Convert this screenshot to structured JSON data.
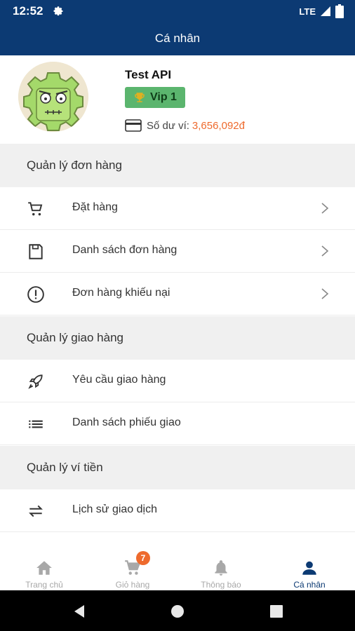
{
  "status_bar": {
    "time": "12:52",
    "network": "LTE"
  },
  "app_bar": {
    "title": "Cá nhân"
  },
  "profile": {
    "name": "Test API",
    "vip_label": "Vip 1",
    "balance_label": "Số dư ví:",
    "balance_value": "3,656,092đ"
  },
  "sections": [
    {
      "title": "Quản lý đơn hàng",
      "items": [
        {
          "label": "Đặt hàng",
          "icon": "cart-icon"
        },
        {
          "label": "Danh sách đơn hàng",
          "icon": "save-icon"
        },
        {
          "label": "Đơn hàng khiếu nại",
          "icon": "alert-circle-icon"
        }
      ]
    },
    {
      "title": "Quản lý giao hàng",
      "items": [
        {
          "label": "Yêu cầu giao hàng",
          "icon": "rocket-icon"
        },
        {
          "label": "Danh sách phiếu giao",
          "icon": "list-icon"
        }
      ]
    },
    {
      "title": "Quản lý ví tiền",
      "items": [
        {
          "label": "Lịch sử giao dịch",
          "icon": "swap-icon"
        }
      ]
    }
  ],
  "bottom_nav": [
    {
      "label": "Trang chủ",
      "icon": "home-icon"
    },
    {
      "label": "Giỏ hàng",
      "icon": "cart-icon",
      "badge": "7"
    },
    {
      "label": "Thông báo",
      "icon": "bell-icon"
    },
    {
      "label": "Cá nhân",
      "icon": "person-icon",
      "active": true
    }
  ],
  "colors": {
    "primary": "#0c3a73",
    "accent": "#ee6a2d",
    "vip": "#5bb56e",
    "section_bg": "#f0f0f0"
  }
}
